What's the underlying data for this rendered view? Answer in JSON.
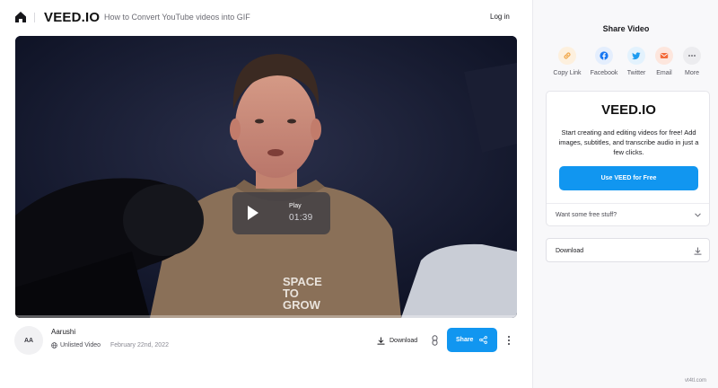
{
  "header": {
    "logo": "VEED.IO",
    "video_title": "How to Convert YouTube videos into GIF",
    "login_label": "Log in"
  },
  "player": {
    "play_label": "Play",
    "duration": "01:39",
    "shirt_text": [
      "SPACE",
      "TO",
      "GROW"
    ]
  },
  "meta": {
    "avatar_initials": "AA",
    "author": "Aarushi",
    "visibility": "Unlisted Video",
    "date": "February 22nd, 2022",
    "download_label": "Download",
    "share_label": "Share"
  },
  "sidebar": {
    "title": "Share Video",
    "share_options": [
      {
        "label": "Copy Link",
        "icon": "link-icon",
        "color": "#f0a648",
        "bg": "#fdf0de"
      },
      {
        "label": "Facebook",
        "icon": "facebook-icon",
        "color": "#1877f2",
        "bg": "#e4eefd"
      },
      {
        "label": "Twitter",
        "icon": "twitter-icon",
        "color": "#1d9bf0",
        "bg": "#e3f2fd"
      },
      {
        "label": "Email",
        "icon": "mail-icon",
        "color": "#f36b3a",
        "bg": "#fde6dd"
      },
      {
        "label": "More",
        "icon": "more-icon",
        "color": "#55555e",
        "bg": "#ececef"
      }
    ],
    "promo": {
      "logo": "VEED.IO",
      "text": "Start creating and editing videos for free! Add images, subtitles, and transcribe audio in just a few clicks.",
      "button_label": "Use VEED for Free",
      "freebie_label": "Want some free stuff?"
    },
    "download_label": "Download"
  },
  "watermark": "vt4tl.com",
  "colors": {
    "accent": "#1196f0",
    "sidebar_bg": "#f8f8fa"
  }
}
